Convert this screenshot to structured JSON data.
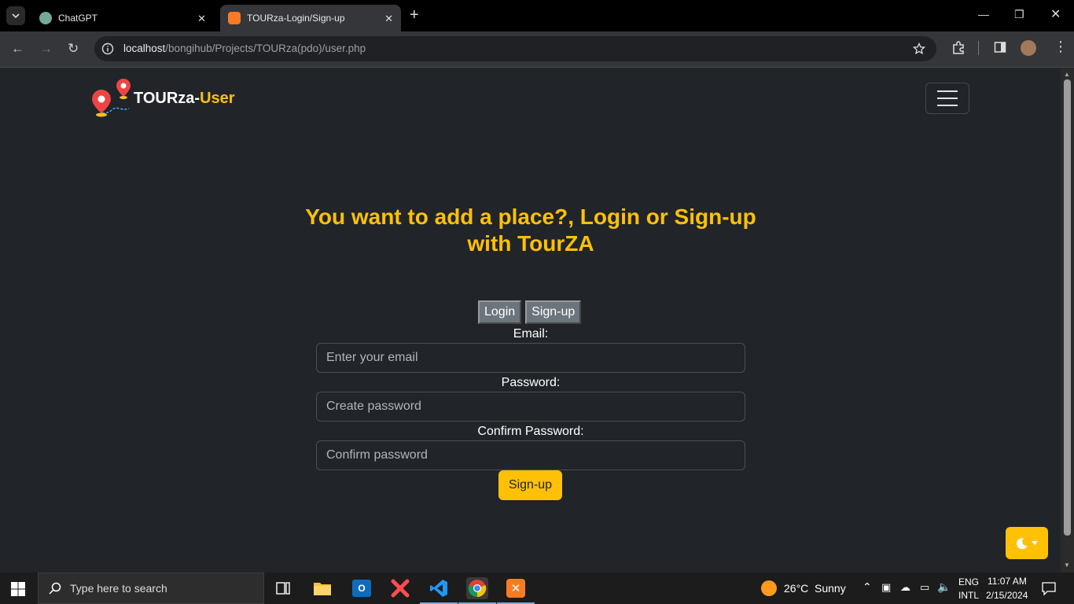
{
  "browser": {
    "tabs": [
      {
        "title": "ChatGPT",
        "active": false
      },
      {
        "title": "TOURza-Login/Sign-up",
        "active": true
      }
    ],
    "url_host": "localhost",
    "url_path": "/bongihub/Projects/TOURza(pdo)/user.php"
  },
  "page": {
    "brand_main": "TOURza-",
    "brand_accent": "User",
    "headline": "You want to add a place?, Login or Sign-up with TourZA",
    "tab_login": "Login",
    "tab_signup": "Sign-up",
    "email_label": "Email:",
    "email_placeholder": "Enter your email",
    "password_label": "Password:",
    "password_placeholder": "Create password",
    "confirm_label": "Confirm Password:",
    "confirm_placeholder": "Confirm password",
    "submit_label": "Sign-up"
  },
  "taskbar": {
    "search_placeholder": "Type here to search",
    "weather_temp": "26°C",
    "weather_text": "Sunny",
    "lang_top": "ENG",
    "lang_bottom": "INTL",
    "time": "11:07 AM",
    "date": "2/15/2024"
  },
  "colors": {
    "accent": "#ffc107",
    "page_bg": "#212529"
  }
}
